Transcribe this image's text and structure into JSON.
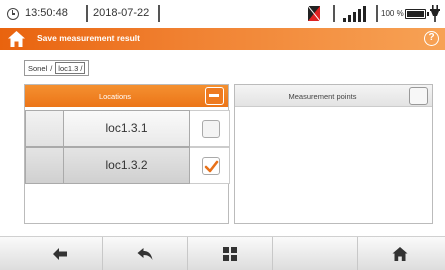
{
  "status": {
    "time": "13:50:48",
    "date": "2018-07-22",
    "battery_percent": "100 %"
  },
  "title_bar": {
    "title": "Save measurement result",
    "help_label": "?"
  },
  "breadcrumb": {
    "items": [
      "Sonel",
      "loc1.3"
    ]
  },
  "locations": {
    "header": "Locations",
    "rows": [
      {
        "name": "loc1.3.1",
        "checked": false
      },
      {
        "name": "loc1.3.2",
        "checked": true
      }
    ]
  },
  "points": {
    "header": "Measurement points"
  },
  "toolbar": {
    "buttons": [
      "arrow-left-icon",
      "undo-icon",
      "grid-icon",
      "empty",
      "home-icon"
    ]
  },
  "colors": {
    "accent": "#f07a1e",
    "check": "#e8711a"
  }
}
